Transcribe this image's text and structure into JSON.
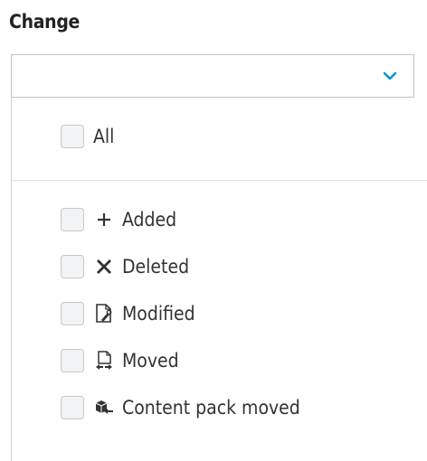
{
  "filter": {
    "title": "Change",
    "select_value": "",
    "dropdown_icon": "chevron-down-icon",
    "accent_color": "#0096d6",
    "options": [
      {
        "label": "All",
        "icon": "",
        "checked": false
      },
      {
        "label": "Added",
        "icon": "plus-icon",
        "checked": false
      },
      {
        "label": "Deleted",
        "icon": "x-icon",
        "checked": false
      },
      {
        "label": "Modified",
        "icon": "modified-document-icon",
        "checked": false
      },
      {
        "label": "Moved",
        "icon": "moved-document-icon",
        "checked": false
      },
      {
        "label": "Content pack moved",
        "icon": "content-pack-moved-icon",
        "checked": false
      }
    ]
  }
}
